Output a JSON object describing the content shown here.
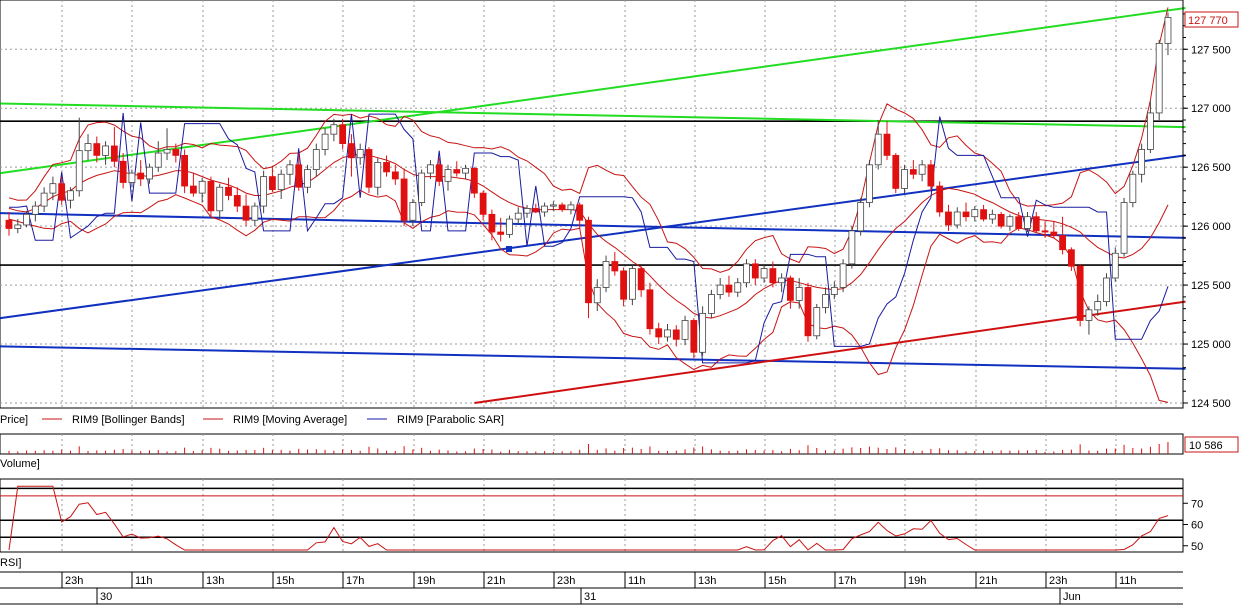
{
  "instrument": "RIM9",
  "price_panel": {
    "legend_price": "Price]",
    "legend_items": [
      {
        "label": "RIM9 [Bollinger Bands]",
        "color": "#c81414"
      },
      {
        "label": "RIM9 [Moving Average]",
        "color": "#c81414"
      },
      {
        "label": "RIM9 [Parabolic SAR]",
        "color": "#1a1aa0"
      }
    ],
    "y_ticks": [
      124500,
      125000,
      125500,
      126000,
      126500,
      127000,
      127500
    ],
    "y_tick_labels": [
      "124 500",
      "125 000",
      "125 500",
      "126 000",
      "126 500",
      "127 000",
      "127 500"
    ],
    "last_price_label": "127 770",
    "ylim": [
      124500,
      127850
    ],
    "horizontal_levels": [
      126890,
      125670
    ]
  },
  "volume_panel": {
    "label": "Volume]",
    "last_value_label": "10 586"
  },
  "rsi_panel": {
    "label": "RSI]",
    "y_ticks": [
      50,
      60,
      70
    ],
    "y_tick_labels": [
      "50",
      "60",
      "70"
    ],
    "levels": [
      77,
      62,
      54
    ],
    "ylim": [
      48,
      80
    ]
  },
  "time_axis": {
    "hour_labels": [
      "23h",
      "11h",
      "13h",
      "15h",
      "17h",
      "19h",
      "21h",
      "23h",
      "11h",
      "13h",
      "15h",
      "17h",
      "19h",
      "21h",
      "23h",
      "11h"
    ],
    "day_labels": [
      "30",
      "31",
      "Jun"
    ]
  },
  "colors": {
    "up_candle": "#ffffff",
    "down_candle": "#e01010",
    "bollinger": "#c81414",
    "sar": "#1a1aa0",
    "trend_green": "#22dd22",
    "trend_blue": "#1030c0",
    "trend_red": "#d01010",
    "level_line": "#000000",
    "grid": "#9a9a9a"
  },
  "chart_data": {
    "type": "candlestick",
    "series": [
      {
        "name": "RIM9 Price",
        "ohlc": [
          [
            126050,
            126120,
            125920,
            125980
          ],
          [
            125980,
            126060,
            125940,
            126010
          ],
          [
            126010,
            126130,
            125990,
            126100
          ],
          [
            126100,
            126210,
            126040,
            126170
          ],
          [
            126170,
            126330,
            126120,
            126280
          ],
          [
            126280,
            126420,
            126220,
            126360
          ],
          [
            126360,
            126420,
            126180,
            126220
          ],
          [
            126220,
            126330,
            126150,
            126300
          ],
          [
            126300,
            126920,
            126250,
            126640
          ],
          [
            126640,
            126780,
            126560,
            126700
          ],
          [
            126700,
            126760,
            126540,
            126600
          ],
          [
            126600,
            126720,
            126520,
            126680
          ],
          [
            126680,
            126840,
            126500,
            126550
          ],
          [
            126550,
            126620,
            126320,
            126370
          ],
          [
            126370,
            126480,
            126330,
            126450
          ],
          [
            126450,
            126560,
            126340,
            126400
          ],
          [
            126400,
            126530,
            126360,
            126500
          ],
          [
            126500,
            126720,
            126460,
            126620
          ],
          [
            126620,
            126830,
            126560,
            126650
          ],
          [
            126650,
            126700,
            126540,
            126600
          ],
          [
            126600,
            126650,
            126280,
            126340
          ],
          [
            126340,
            126450,
            126250,
            126280
          ],
          [
            126280,
            126410,
            126200,
            126380
          ],
          [
            126380,
            126420,
            126080,
            126130
          ],
          [
            126130,
            126360,
            126060,
            126330
          ],
          [
            126330,
            126410,
            126220,
            126260
          ],
          [
            126260,
            126330,
            126120,
            126170
          ],
          [
            126170,
            126270,
            126000,
            126050
          ],
          [
            126050,
            126200,
            126000,
            126170
          ],
          [
            126170,
            126470,
            126110,
            126420
          ],
          [
            126420,
            126510,
            126290,
            126310
          ],
          [
            126310,
            126480,
            126230,
            126440
          ],
          [
            126440,
            126560,
            126350,
            126520
          ],
          [
            126520,
            126620,
            126300,
            126330
          ],
          [
            126330,
            126520,
            126280,
            126480
          ],
          [
            126480,
            126700,
            126420,
            126650
          ],
          [
            126650,
            126830,
            126600,
            126780
          ],
          [
            126780,
            126910,
            126720,
            126860
          ],
          [
            126860,
            126910,
            126650,
            126700
          ],
          [
            126700,
            126780,
            126420,
            126580
          ],
          [
            126580,
            126700,
            126520,
            126650
          ],
          [
            126650,
            126670,
            126280,
            126330
          ],
          [
            126330,
            126580,
            126260,
            126540
          ],
          [
            126540,
            126600,
            126420,
            126460
          ],
          [
            126460,
            126520,
            126350,
            126400
          ],
          [
            126400,
            126490,
            126000,
            126050
          ],
          [
            126050,
            126230,
            126000,
            126200
          ],
          [
            126200,
            126480,
            126170,
            126450
          ],
          [
            126450,
            126560,
            126400,
            126520
          ],
          [
            126520,
            126580,
            126340,
            126380
          ],
          [
            126380,
            126520,
            126300,
            126480
          ],
          [
            126480,
            126550,
            126420,
            126450
          ],
          [
            126450,
            126520,
            126400,
            126490
          ],
          [
            126490,
            126500,
            126240,
            126280
          ],
          [
            126280,
            126300,
            126050,
            126100
          ],
          [
            126100,
            126140,
            125880,
            125950
          ],
          [
            125950,
            126070,
            125870,
            125930
          ],
          [
            125930,
            126090,
            125900,
            126060
          ],
          [
            126060,
            126160,
            126020,
            126110
          ],
          [
            126110,
            126180,
            126070,
            126150
          ],
          [
            126150,
            126190,
            126110,
            126120
          ],
          [
            126120,
            126200,
            126080,
            126170
          ],
          [
            126170,
            126210,
            126130,
            126180
          ],
          [
            126180,
            126200,
            126120,
            126140
          ],
          [
            126140,
            126210,
            126100,
            126180
          ],
          [
            126180,
            126200,
            125980,
            126050
          ],
          [
            126050,
            126080,
            125220,
            125350
          ],
          [
            125350,
            125550,
            125280,
            125480
          ],
          [
            125480,
            125750,
            125440,
            125700
          ],
          [
            125700,
            125780,
            125580,
            125620
          ],
          [
            125620,
            125650,
            125320,
            125380
          ],
          [
            125380,
            125680,
            125330,
            125640
          ],
          [
            125640,
            125660,
            125400,
            125460
          ],
          [
            125460,
            125520,
            125080,
            125130
          ],
          [
            125130,
            125180,
            125000,
            125060
          ],
          [
            125060,
            125170,
            125020,
            125120
          ],
          [
            125120,
            125160,
            124980,
            125040
          ],
          [
            125040,
            125240,
            124990,
            125200
          ],
          [
            125200,
            125220,
            124880,
            124930
          ],
          [
            124930,
            125320,
            124900,
            125260
          ],
          [
            125260,
            125460,
            125220,
            125420
          ],
          [
            125420,
            125560,
            125380,
            125500
          ],
          [
            125500,
            125580,
            125400,
            125440
          ],
          [
            125440,
            125560,
            125400,
            125520
          ],
          [
            125520,
            125720,
            125480,
            125680
          ],
          [
            125680,
            125720,
            125500,
            125560
          ],
          [
            125560,
            125680,
            125520,
            125640
          ],
          [
            125640,
            125700,
            125480,
            125520
          ],
          [
            125520,
            125600,
            125440,
            125560
          ],
          [
            125560,
            125580,
            125300,
            125370
          ],
          [
            125370,
            125560,
            125300,
            125480
          ],
          [
            125480,
            125520,
            125020,
            125070
          ],
          [
            125070,
            125340,
            125040,
            125310
          ],
          [
            125310,
            125480,
            125260,
            125420
          ],
          [
            125420,
            125530,
            125380,
            125480
          ],
          [
            125480,
            125720,
            125440,
            125680
          ],
          [
            125680,
            126000,
            125640,
            125960
          ],
          [
            125960,
            126240,
            125920,
            126200
          ],
          [
            126200,
            126560,
            126160,
            126520
          ],
          [
            126520,
            126900,
            126480,
            126780
          ],
          [
            126780,
            126890,
            126560,
            126600
          ],
          [
            126600,
            126620,
            126280,
            126320
          ],
          [
            126320,
            126520,
            126280,
            126480
          ],
          [
            126480,
            126560,
            126400,
            126440
          ],
          [
            126440,
            126560,
            126380,
            126520
          ],
          [
            126520,
            126560,
            126300,
            126340
          ],
          [
            126340,
            126380,
            126080,
            126120
          ],
          [
            126120,
            126180,
            125960,
            126010
          ],
          [
            126010,
            126160,
            125980,
            126120
          ],
          [
            126120,
            126200,
            126040,
            126080
          ],
          [
            126080,
            126170,
            126040,
            126140
          ],
          [
            126140,
            126180,
            126040,
            126060
          ],
          [
            126060,
            126140,
            126020,
            126100
          ],
          [
            126100,
            126120,
            125980,
            126000
          ],
          [
            126000,
            126100,
            125960,
            126080
          ],
          [
            126080,
            126120,
            125960,
            125980
          ],
          [
            125980,
            126120,
            125950,
            126080
          ],
          [
            126080,
            126120,
            125940,
            125960
          ],
          [
            125960,
            126040,
            125900,
            125950
          ],
          [
            125950,
            126040,
            125900,
            125920
          ],
          [
            125920,
            126080,
            125760,
            125800
          ],
          [
            125800,
            125820,
            125620,
            125660
          ],
          [
            125660,
            125680,
            125150,
            125200
          ],
          [
            125200,
            125320,
            125080,
            125290
          ],
          [
            125290,
            125420,
            125240,
            125360
          ],
          [
            125360,
            125600,
            125320,
            125560
          ],
          [
            125560,
            125820,
            125530,
            125770
          ],
          [
            125770,
            126240,
            125740,
            126200
          ],
          [
            126200,
            126470,
            126160,
            126440
          ],
          [
            126440,
            126700,
            126370,
            126650
          ],
          [
            126650,
            127060,
            126620,
            126960
          ],
          [
            126960,
            127580,
            126900,
            127550
          ],
          [
            127550,
            127810,
            127450,
            127770
          ]
        ]
      },
      {
        "name": "Moving Average",
        "values": [
          126150,
          126130,
          126120,
          126150,
          126200,
          126250,
          126280,
          126300,
          126360,
          126400,
          126430,
          126450,
          126470,
          126460,
          126440,
          126430,
          126420,
          126430,
          126450,
          126470,
          126470,
          126450,
          126420,
          126390,
          126370,
          126350,
          126320,
          126280,
          126260,
          126260,
          126280,
          126300,
          126330,
          126350,
          126370,
          126420,
          126480,
          126540,
          126580,
          126600,
          126610,
          126600,
          126580,
          126560,
          126530,
          126480,
          126440,
          126420,
          126420,
          126420,
          126420,
          126410,
          126400,
          126380,
          126340,
          126290,
          126240,
          126200,
          126170,
          126150,
          126140,
          126140,
          126140,
          126140,
          126140,
          126130,
          126020,
          125930,
          125870,
          125820,
          125760,
          125700,
          125650,
          125580,
          125500,
          125430,
          125370,
          125320,
          125260,
          125230,
          125220,
          125240,
          125270,
          125300,
          125350,
          125420,
          125470,
          125510,
          125540,
          125540,
          125520,
          125500,
          125480,
          125470,
          125460,
          125470,
          125520,
          125590,
          125690,
          125800,
          125900,
          125980,
          126040,
          126120,
          126200,
          126260,
          126300,
          126320,
          126310,
          126290,
          126270,
          126230,
          126200,
          126160,
          126120,
          126090,
          126070,
          126060,
          126050,
          126040,
          126020,
          125990,
          125950,
          125880,
          125820,
          125780,
          125740,
          125730,
          125760,
          125810,
          125900,
          126030,
          126180
        ]
      }
    ],
    "x": [
      "23h",
      "11h",
      "13h",
      "15h",
      "17h",
      "19h",
      "21h",
      "23h",
      "11h",
      "13h",
      "15h",
      "17h",
      "19h",
      "21h",
      "23h",
      "11h"
    ],
    "ylim": [
      124500,
      127850
    ],
    "title": ""
  }
}
